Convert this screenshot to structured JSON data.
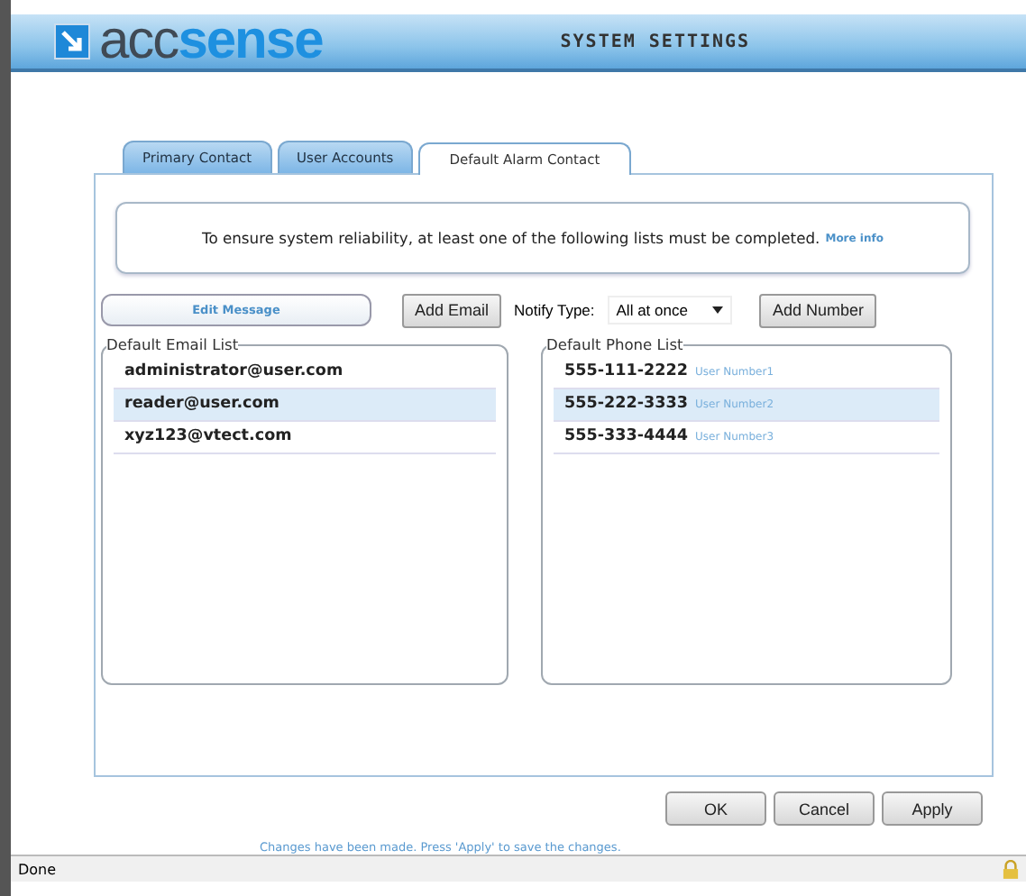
{
  "header": {
    "logo": "acc**sense**",
    "title": "SYSTEM SETTINGS"
  },
  "tabs": [
    {
      "label": "Primary Contact",
      "selected": false
    },
    {
      "label": "User Accounts",
      "selected": false
    },
    {
      "label": "Default Alarm Contact",
      "selected": true
    }
  ],
  "notice": {
    "text": "To ensure system reliability, at least one of the following lists must be completed.",
    "link": "More info"
  },
  "toolbar": {
    "edit_message": "Edit Message",
    "add_email": "Add Email",
    "notify_label": "Notify Type:",
    "notify_value": "All at once",
    "add_number": "Add Number"
  },
  "email_list": {
    "legend": "Default Email List",
    "rows": [
      {
        "email": "administrator@user.com",
        "selected": false
      },
      {
        "email": "reader@user.com",
        "selected": true
      },
      {
        "email": "xyz123@vtect.com",
        "selected": false
      }
    ]
  },
  "phone_list": {
    "legend": "Default Phone List",
    "rows": [
      {
        "number": "555-111-2222",
        "label": "User Number1",
        "selected": false
      },
      {
        "number": "555-222-3333",
        "label": "User Number2",
        "selected": true
      },
      {
        "number": "555-333-4444",
        "label": "User Number3",
        "selected": false
      }
    ]
  },
  "buttons": [
    "OK",
    "Cancel",
    "Apply"
  ],
  "message": "Changes have been made. Press 'Apply' to save the changes.",
  "status_bar": "Done"
}
